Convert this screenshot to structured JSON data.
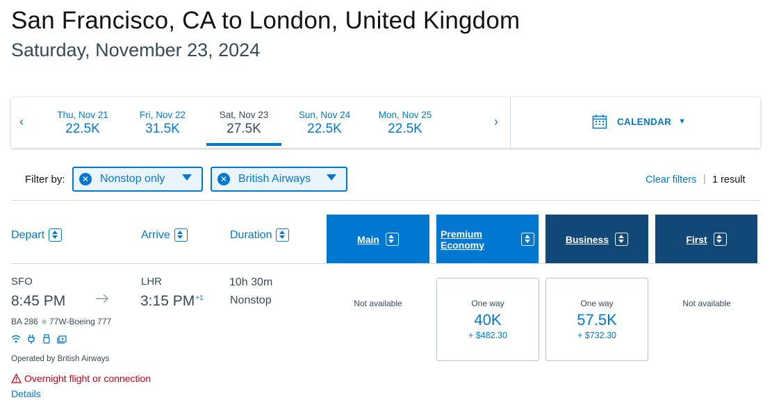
{
  "header": {
    "title": "San Francisco, CA to London, United Kingdom",
    "subtitle": "Saturday, November 23, 2024"
  },
  "datebar": {
    "dates": [
      {
        "day": "Thu, Nov 21",
        "price": "22.5K"
      },
      {
        "day": "Fri, Nov 22",
        "price": "31.5K"
      },
      {
        "day": "Sat, Nov 23",
        "price": "27.5K",
        "selected": true
      },
      {
        "day": "Sun, Nov 24",
        "price": "22.5K"
      },
      {
        "day": "Mon, Nov 25",
        "price": "22.5K"
      }
    ],
    "prev_arrow": "‹",
    "next_arrow": "›",
    "calendar_label": "CALENDAR"
  },
  "filters": {
    "label": "Filter by:",
    "chips": [
      "Nonstop only",
      "British Airways"
    ],
    "clear_label": "Clear filters",
    "separator": "|",
    "result_count": "1 result"
  },
  "columns": {
    "depart": "Depart",
    "arrive": "Arrive",
    "duration": "Duration",
    "cabins": [
      "Main",
      "Premium Economy",
      "Business",
      "First"
    ]
  },
  "flight": {
    "origin": "SFO",
    "depart_time": "8:45 PM",
    "destination": "LHR",
    "arrive_time": "3:15 PM",
    "day_offset": "+1",
    "duration": "10h 30m",
    "stops": "Nonstop",
    "flight_number": "BA 286",
    "aircraft": "77W-Boeing 777",
    "operated_by": "Operated by British Airways",
    "warning": "Overnight flight or connection",
    "details_label": "Details",
    "amenity_icons": [
      "wifi-icon",
      "power-plug-icon",
      "usb-icon",
      "entertainment-icon"
    ],
    "fares": {
      "main": "Not available",
      "premium": {
        "label": "One way",
        "points": "40K",
        "cash": "+ $482.30"
      },
      "business": {
        "label": "One way",
        "points": "57.5K",
        "cash": "+ $732.30"
      },
      "first": "Not available"
    }
  },
  "colors": {
    "accent": "#0078d2",
    "dark_cabin": "#124877",
    "warning": "#c30019",
    "text": "#36495a"
  }
}
